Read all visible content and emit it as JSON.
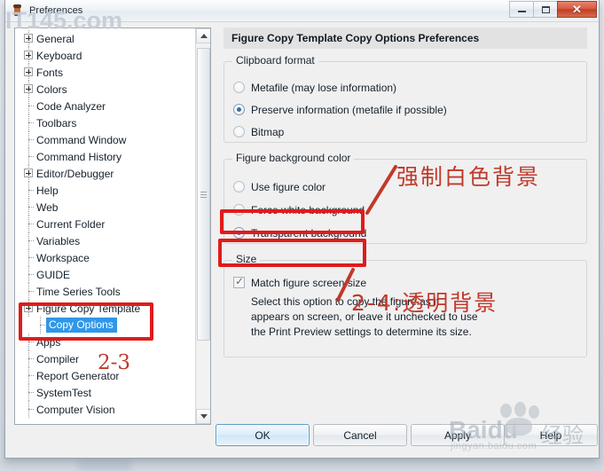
{
  "window": {
    "title": "Preferences",
    "icon": "matlab-icon",
    "controls": {
      "minimize": "minimize-icon",
      "maximize": "maximize-icon",
      "close": "✕"
    }
  },
  "tree": {
    "items": [
      {
        "label": "General",
        "expandable": true,
        "child": false,
        "selected": false
      },
      {
        "label": "Keyboard",
        "expandable": true,
        "child": false,
        "selected": false
      },
      {
        "label": "Fonts",
        "expandable": true,
        "child": false,
        "selected": false
      },
      {
        "label": "Colors",
        "expandable": true,
        "child": false,
        "selected": false
      },
      {
        "label": "Code Analyzer",
        "expandable": false,
        "child": false,
        "selected": false
      },
      {
        "label": "Toolbars",
        "expandable": false,
        "child": false,
        "selected": false
      },
      {
        "label": "Command Window",
        "expandable": false,
        "child": false,
        "selected": false
      },
      {
        "label": "Command History",
        "expandable": false,
        "child": false,
        "selected": false
      },
      {
        "label": "Editor/Debugger",
        "expandable": true,
        "child": false,
        "selected": false
      },
      {
        "label": "Help",
        "expandable": false,
        "child": false,
        "selected": false
      },
      {
        "label": "Web",
        "expandable": false,
        "child": false,
        "selected": false
      },
      {
        "label": "Current Folder",
        "expandable": false,
        "child": false,
        "selected": false
      },
      {
        "label": "Variables",
        "expandable": false,
        "child": false,
        "selected": false
      },
      {
        "label": "Workspace",
        "expandable": false,
        "child": false,
        "selected": false
      },
      {
        "label": "GUIDE",
        "expandable": false,
        "child": false,
        "selected": false
      },
      {
        "label": "Time Series Tools",
        "expandable": false,
        "child": false,
        "selected": false
      },
      {
        "label": "Figure Copy Template",
        "expandable": true,
        "child": false,
        "selected": false
      },
      {
        "label": "Copy Options",
        "expandable": false,
        "child": true,
        "selected": true
      },
      {
        "label": "Apps",
        "expandable": false,
        "child": false,
        "selected": false
      },
      {
        "label": "Compiler",
        "expandable": false,
        "child": false,
        "selected": false
      },
      {
        "label": "Report Generator",
        "expandable": false,
        "child": false,
        "selected": false
      },
      {
        "label": "SystemTest",
        "expandable": false,
        "child": false,
        "selected": false
      },
      {
        "label": "Computer Vision",
        "expandable": false,
        "child": false,
        "selected": false
      }
    ]
  },
  "pane": {
    "header": "Figure Copy Template Copy Options Preferences",
    "clipboard_format": {
      "legend": "Clipboard format",
      "options": [
        {
          "label": "Metafile (may lose information)",
          "checked": false
        },
        {
          "label": "Preserve information (metafile if possible)",
          "checked": true
        },
        {
          "label": "Bitmap",
          "checked": false
        }
      ]
    },
    "figure_background_color": {
      "legend": "Figure background color",
      "options": [
        {
          "label": "Use figure color",
          "checked": false
        },
        {
          "label": "Force white background",
          "checked": false
        },
        {
          "label": "Transparent background",
          "checked": true
        }
      ]
    },
    "size": {
      "legend": "Size",
      "checkbox": {
        "label": "Match figure screen size",
        "checked": true
      },
      "help_line1": "Select this option to copy the figure as it",
      "help_line2": "appears on screen, or leave it unchecked to use",
      "help_line3": "the Print Preview settings to determine its size."
    }
  },
  "buttons": {
    "ok": "OK",
    "cancel": "Cancel",
    "apply": "Apply",
    "help": "Help"
  },
  "annotations": {
    "color": "#e01b1b",
    "text_color": "#c0392b",
    "force_white_label": "强制白色背景",
    "transparent_label": "2-4:透明背景",
    "step_label": "2-3"
  },
  "watermarks": {
    "it145": "IT145.com",
    "baidu_main": "Baidu",
    "baidu_cn": "经验",
    "baidu_sub": "jingyan.baidu.com"
  }
}
